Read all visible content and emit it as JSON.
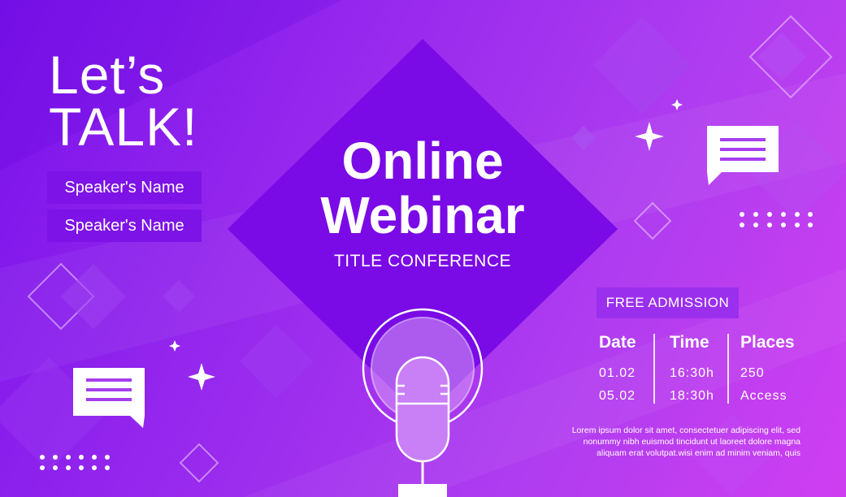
{
  "headline": {
    "line1": "Let’s",
    "line2": "TALK!"
  },
  "speakers": [
    "Speaker's Name",
    "Speaker's Name"
  ],
  "title": {
    "line1": "Online",
    "line2": "Webinar",
    "subtitle": "TITLE CONFERENCE"
  },
  "admission": "FREE ADMISSION",
  "schedule": {
    "date": {
      "header": "Date",
      "values": [
        "01.02",
        "05.02"
      ]
    },
    "time": {
      "header": "Time",
      "values": [
        "16:30h",
        "18:30h"
      ]
    },
    "places": {
      "header": "Places",
      "values": [
        "250",
        "Access"
      ]
    }
  },
  "lorem": [
    "Lorem ipsum dolor sit amet, consectetuer adipiscing elit, sed",
    "nonummy nibh euismod tincidunt ut laoreet dolore magna",
    "aliquam erat volutpat.wisi enim ad minim veniam, quis"
  ],
  "icons": [
    "chat-bubble-icon",
    "sparkle-icon",
    "microphone-icon",
    "diamond-icon"
  ],
  "colors": {
    "primary": "#7a12ea",
    "accent": "#cf3ef1",
    "panel": "#7d13e6",
    "white": "#ffffff"
  }
}
